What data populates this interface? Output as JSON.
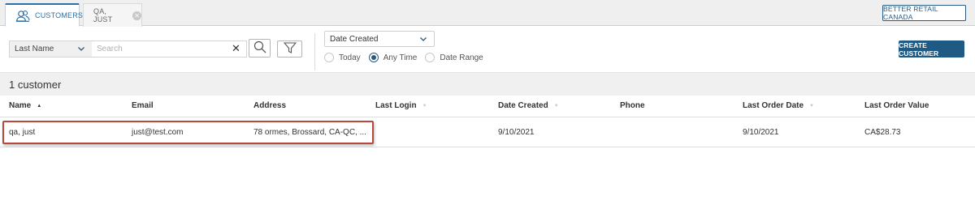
{
  "tabs": [
    {
      "label": "CUSTOMERS",
      "icon": "customers-icon"
    },
    {
      "label": "QA, JUST",
      "icon": "close-icon"
    }
  ],
  "store_label": "BETTER RETAIL CANADA",
  "filters": {
    "field_select": "Last Name",
    "search_placeholder": "Search",
    "clear_glyph": "✕",
    "date_select": "Date Created",
    "radios": [
      {
        "label": "Today",
        "selected": false
      },
      {
        "label": "Any Time",
        "selected": true
      },
      {
        "label": "Date Range",
        "selected": false
      }
    ]
  },
  "create_label": "CREATE CUSTOMER",
  "count_label": "1 customer",
  "table": {
    "columns": [
      "Name",
      "Email",
      "Address",
      "Last Login",
      "Date Created",
      "Phone",
      "Last Order Date",
      "Last Order Value"
    ],
    "rows": [
      [
        "qa, just",
        "just@test.com",
        "78 ormes, Brossard, CA-QC, ...",
        "",
        "9/10/2021",
        "",
        "9/10/2021",
        "CA$28.73"
      ]
    ]
  },
  "colors": {
    "accent": "#1f5a85",
    "highlight": "#b8493a"
  }
}
